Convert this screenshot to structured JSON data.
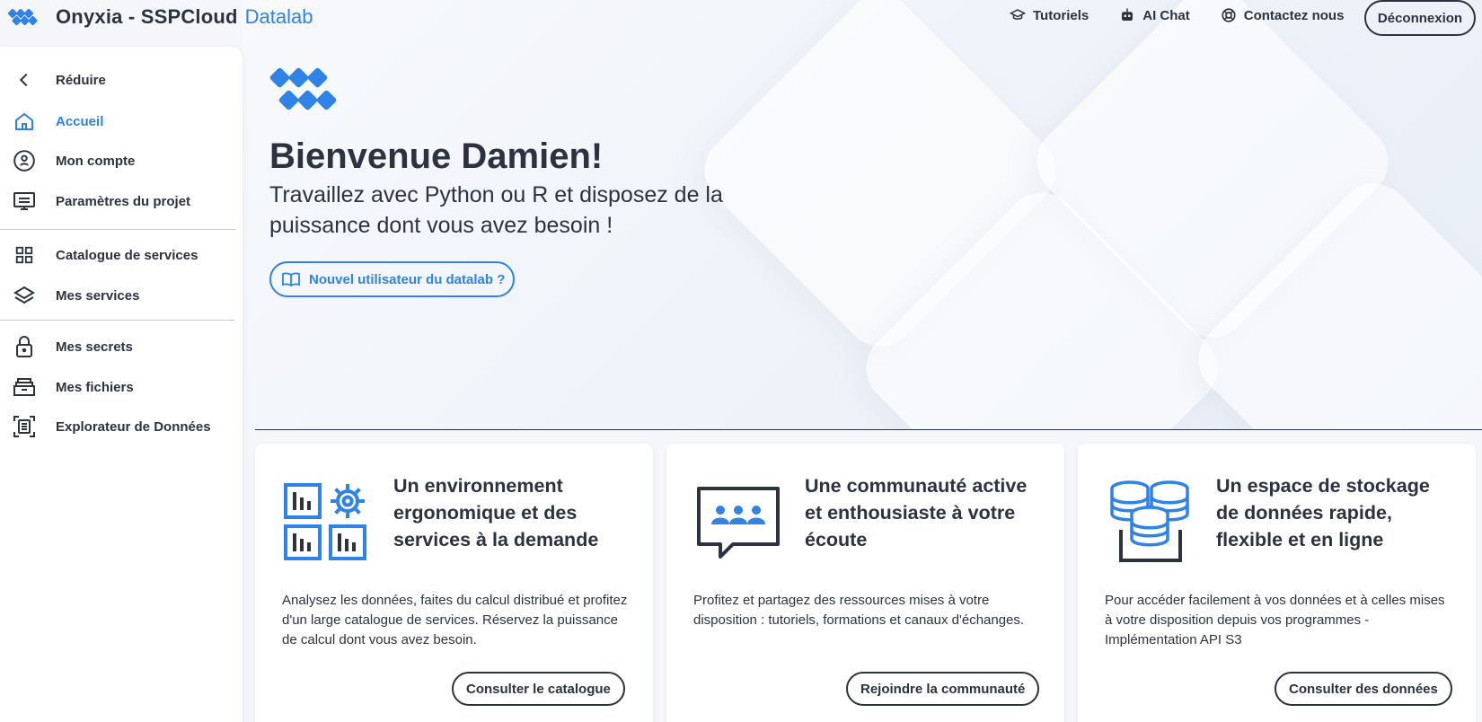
{
  "header": {
    "brand_name": "Onyxia - SSPCloud",
    "brand_sub": "Datalab",
    "links": [
      {
        "label": "Tutoriels",
        "icon": "graduation-cap-icon"
      },
      {
        "label": "AI Chat",
        "icon": "robot-icon"
      },
      {
        "label": "Contactez nous",
        "icon": "lifebuoy-icon"
      }
    ],
    "logout_label": "Déconnexion"
  },
  "sidebar": {
    "items": [
      {
        "label": "Réduire",
        "icon": "chevron-left-icon",
        "active": false
      },
      {
        "label": "Accueil",
        "icon": "home-icon",
        "active": true
      },
      {
        "label": "Mon compte",
        "icon": "account-icon",
        "active": false
      },
      {
        "label": "Paramètres du projet",
        "icon": "project-settings-icon",
        "active": false
      },
      {
        "label": "Catalogue de services",
        "icon": "grid-icon",
        "active": false
      },
      {
        "label": "Mes services",
        "icon": "layers-icon",
        "active": false
      },
      {
        "label": "Mes secrets",
        "icon": "lock-icon",
        "active": false
      },
      {
        "label": "Mes fichiers",
        "icon": "files-icon",
        "active": false
      },
      {
        "label": "Explorateur de Données",
        "icon": "data-explorer-icon",
        "active": false
      }
    ]
  },
  "hero": {
    "title": "Bienvenue Damien!",
    "subtitle": "Travaillez avec Python ou R et disposez de la puissance dont vous avez besoin !",
    "new_user_label": "Nouvel utilisateur du datalab ?"
  },
  "cards": [
    {
      "title": "Un environnement ergonomique et des services à la demande",
      "text": "Analysez les données, faites du calcul distribué et profitez d'un large catalogue de services. Réservez la puissance de calcul dont vous avez besoin.",
      "button": "Consulter le catalogue",
      "icon": "dashboard-services-icon"
    },
    {
      "title": "Une communauté active et enthousiaste à votre écoute",
      "text": "Profitez et partagez des ressources mises à votre disposition : tutoriels, formations et canaux d'échanges.",
      "button": "Rejoindre la communauté",
      "icon": "community-chat-icon"
    },
    {
      "title": "Un espace de stockage de données rapide, flexible et en ligne",
      "text": "Pour accéder facilement à vos données et à celles mises à votre disposition depuis vos programmes - Implémentation API S3",
      "button": "Consulter des données",
      "icon": "database-storage-icon"
    }
  ],
  "colors": {
    "accent": "#2f82e6",
    "text": "#2c323f",
    "background": "#f4f6fa"
  }
}
